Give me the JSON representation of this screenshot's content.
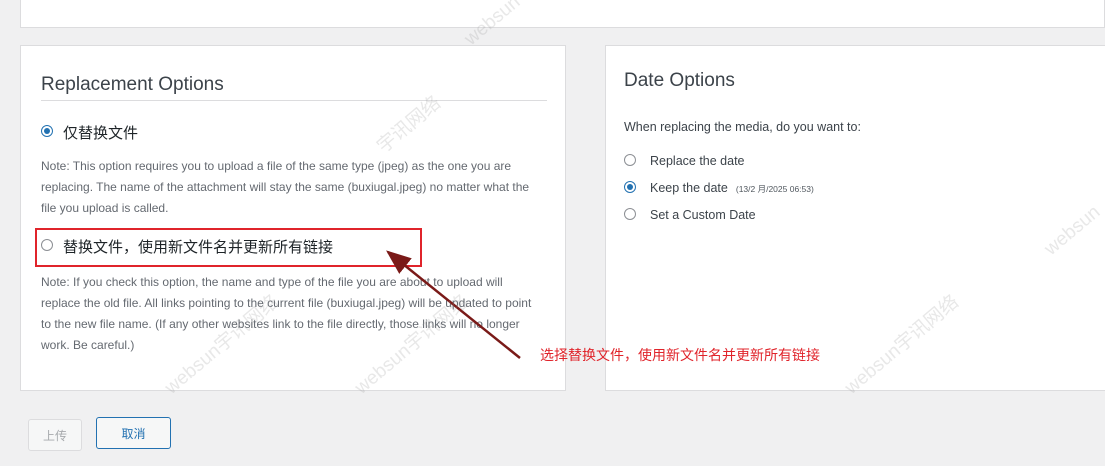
{
  "replacement": {
    "title": "Replacement Options",
    "option1_label": "仅替换文件",
    "option1_note": "Note: This option requires you to upload a file of the same type (jpeg) as the one you are replacing. The name of the attachment will stay the same (buxiugal.jpeg) no matter what the file you upload is called.",
    "option2_label": "替换文件，使用新文件名并更新所有链接",
    "option2_note": "Note: If you check this option, the name and type of the file you are about to upload will replace the old file. All links pointing to the current file (buxiugal.jpeg) will be updated to point to the new file name. (If any other websites link to the file directly, those links will no longer work. Be careful.)",
    "selected_option": "仅替换文件"
  },
  "date": {
    "title": "Date Options",
    "question": "When replacing the media, do you want to:",
    "options": [
      "Replace the date",
      "Keep the date",
      "Set a Custom Date"
    ],
    "keep_date_stamp": "(13/2 月/2025 06:53)",
    "selected_option": "Keep the date"
  },
  "annotation": {
    "text": "选择替换文件，使用新文件名并更新所有链接",
    "color": "#e0242b"
  },
  "buttons": {
    "upload_label": "上传",
    "cancel_label": "取消"
  },
  "watermark": {
    "text_full": "websun宇讯网络",
    "text_short": "websun",
    "text_cn": "宇讯网络"
  },
  "colors": {
    "accent": "#2271b1",
    "annotation_red": "#e0242b"
  }
}
